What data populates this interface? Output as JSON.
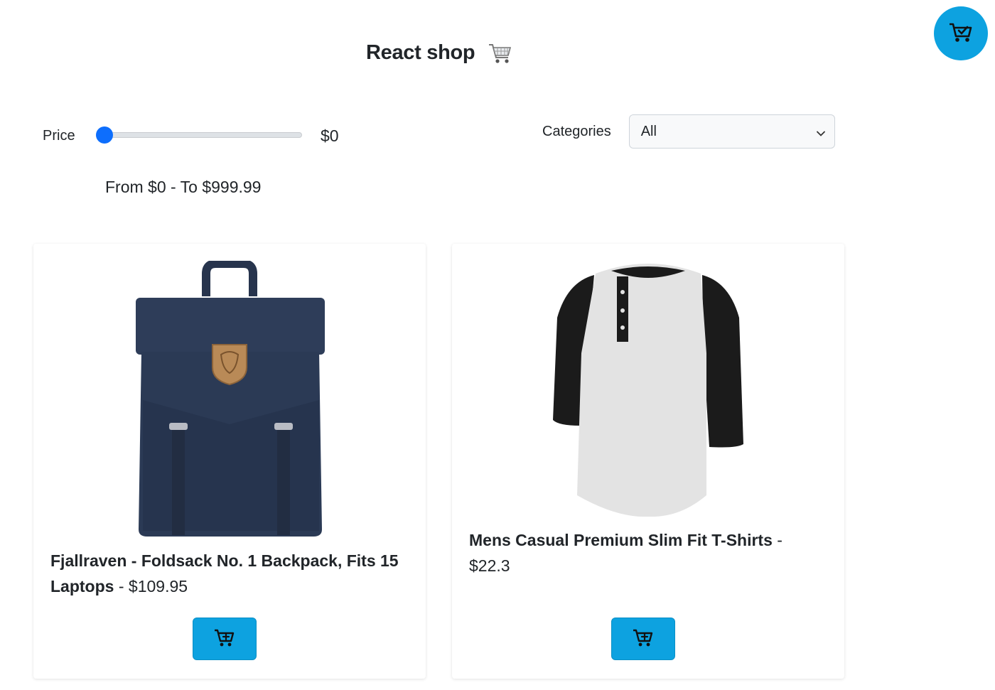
{
  "header": {
    "title": "React shop"
  },
  "filters": {
    "price_label": "Price",
    "price_value": "$0",
    "price_fraction": 0.0,
    "range_text": "From $0 - To $999.99",
    "categories_label": "Categories",
    "categories_selected": "All"
  },
  "products": [
    {
      "name": "Fjallraven - Foldsack No. 1 Backpack, Fits 15 Laptops",
      "separator": " - ",
      "price": "$109.95"
    },
    {
      "name": "Mens Casual Premium Slim Fit T-Shirts",
      "separator": " - ",
      "price": "$22.3"
    }
  ],
  "colors": {
    "accent": "#0da2e0",
    "slider_thumb": "#0d6efd",
    "backpack": "#2b3a55",
    "shirt_body": "#e3e3e3",
    "shirt_sleeve": "#1a1a1a"
  },
  "icons": {
    "cart_fab": "cart-check-icon",
    "title_cart": "shopping-cart-icon",
    "add_to_cart": "cart-plus-icon",
    "select_chevron": "chevron-down-icon"
  }
}
